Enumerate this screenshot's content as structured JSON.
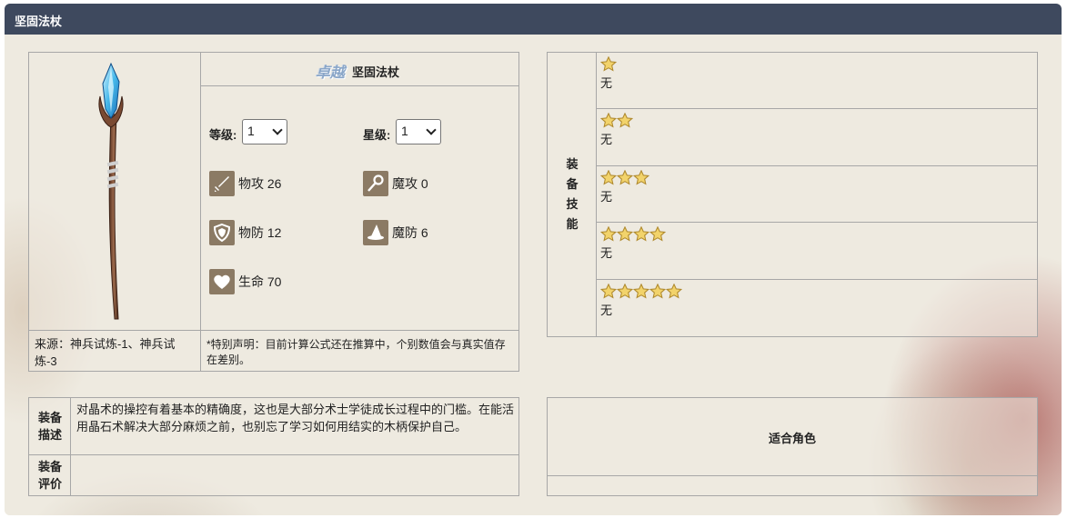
{
  "panel": {
    "title": "坚固法杖"
  },
  "item": {
    "rarity": "卓越",
    "name": "坚固法杖",
    "level_label": "等级:",
    "level_value": "1",
    "star_label": "星级:",
    "star_value": "1",
    "stats": {
      "phys_atk": "物攻 26",
      "mag_atk": "魔攻 0",
      "phys_def": "物防 12",
      "mag_def": "魔防 6",
      "hp": "生命 70"
    },
    "source": "来源：神兵试炼-1、神兵试炼-3",
    "note": "*特别声明：目前计算公式还在推算中，个别数值会与真实值存在差别。"
  },
  "skills": {
    "label_chars": [
      "装",
      "备",
      "技",
      "能"
    ],
    "tiers": [
      {
        "stars": 1,
        "text": "无"
      },
      {
        "stars": 2,
        "text": "无"
      },
      {
        "stars": 3,
        "text": "无"
      },
      {
        "stars": 4,
        "text": "无"
      },
      {
        "stars": 5,
        "text": "无"
      }
    ]
  },
  "description": {
    "label_line1": "装备",
    "label_line2": "描述",
    "text": "对晶术的操控有着基本的精确度，这也是大部分术士学徒成长过程中的门槛。在能活用晶石术解决大部分麻烦之前，也别忘了学习如何用结实的木柄保护自己。"
  },
  "review": {
    "label_line1": "装备",
    "label_line2": "评价",
    "text": ""
  },
  "fit": {
    "title": "适合角色"
  },
  "colors": {
    "header": "#3e495e",
    "panel": "#eeeae0",
    "border": "#a7a7a7",
    "icon_bg": "#8b7a64",
    "star": "#f2d36b"
  }
}
